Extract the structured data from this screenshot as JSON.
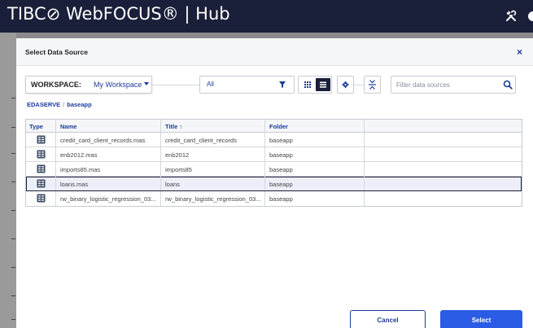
{
  "app": {
    "brand": "TIBC⊘ WebFOCUS® | Hub",
    "icons": [
      "tools-icon",
      "avatar-icon"
    ]
  },
  "dialog": {
    "title": "Select Data Source",
    "close_label": "×"
  },
  "toolbar": {
    "workspace_label": "WORKSPACE:",
    "workspace_value": "My Workspace",
    "filter_value": "All",
    "search_placeholder": "Filter data sources",
    "active_view": "list"
  },
  "breadcrumb": {
    "root": "EDASERVE",
    "separator": "/",
    "folder": "baseapp"
  },
  "table": {
    "columns": {
      "type": "Type",
      "name": "Name",
      "title": "Title ↑",
      "folder": "Folder"
    },
    "rows": [
      {
        "name": "credit_card_client_records.mas",
        "title": "credit_card_client_records",
        "folder": "baseapp"
      },
      {
        "name": "enb2012.mas",
        "title": "enb2012",
        "folder": "baseapp"
      },
      {
        "name": "imports85.mas",
        "title": "imports85",
        "folder": "baseapp"
      },
      {
        "name": "loans.mas",
        "title": "loans",
        "folder": "baseapp"
      },
      {
        "name": "rw_binary_logistic_regression_03...",
        "title": "rw_binary_logistic_regression_03...",
        "folder": "baseapp"
      }
    ],
    "selected_row": "loans.mas"
  },
  "buttons": {
    "cancel": "Cancel",
    "select": "Select"
  },
  "colors": {
    "topbar": "#1a1f3a",
    "accent": "#1c3b9a",
    "primary_button": "#2b5ce6",
    "selected_row": "#eceef8"
  }
}
